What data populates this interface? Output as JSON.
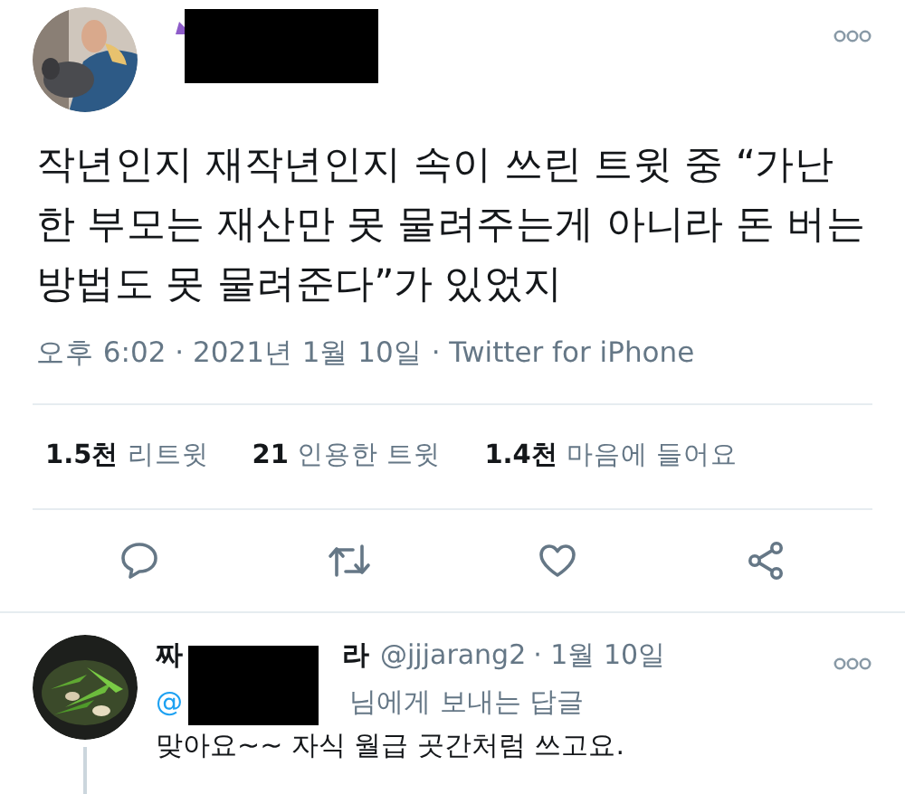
{
  "tweet": {
    "text": "작년인지 재작년인지 속이 쓰린 트윗 중 “가난한 부모는 재산만 못 물려주는게 아니라 돈 버는 방법도 못 물려준다”가 있었지",
    "meta": "오후 6:02 · 2021년 1월 10일 · Twitter for iPhone"
  },
  "stats": [
    {
      "count": "1.5천",
      "label": "리트윗"
    },
    {
      "count": "21",
      "label": "인용한 트윗"
    },
    {
      "count": "1.4천",
      "label": "마음에 들어요"
    }
  ],
  "actions": [
    {
      "kind": "reply"
    },
    {
      "kind": "retweet"
    },
    {
      "kind": "like"
    },
    {
      "kind": "share"
    }
  ],
  "reply": {
    "name_start": "짜",
    "name_end": "라",
    "handle": "@jjjarang2",
    "date": "· 1월 10일",
    "mention": "@",
    "replying_to": "님에게 보내는 답글",
    "text": "맞아요~~ 자식 월급 곳간처럼 쓰고요."
  }
}
